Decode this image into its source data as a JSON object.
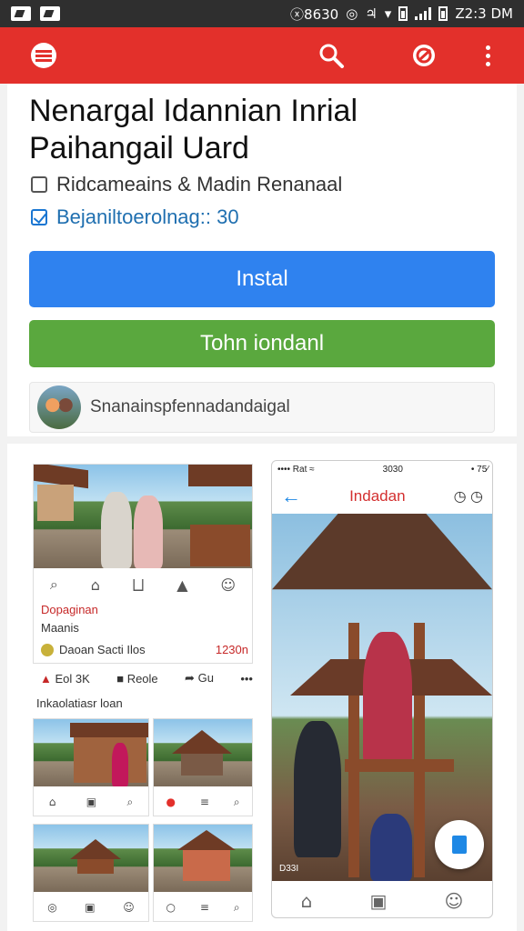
{
  "status_bar": {
    "net": "ⓧ8630",
    "time": "Z2:3 DM"
  },
  "app_bar": {
    "menu_icon": "menu-icon",
    "search_icon": "search-icon",
    "badge_icon": "no-entry-icon",
    "more_icon": "more-vert-icon",
    "accent": "#e3302b"
  },
  "app_info": {
    "title_line1": "Nenargal Idannian Inrial",
    "title_line2": "Paihangail Uard",
    "option1": "Ridcameains & Madin Renanaal",
    "option2": "Bejaniltoerolnag:: 30",
    "install_label": "Instal",
    "secondary_label": "Tohn iondanl",
    "user_text": "Snanainspfennadandaigal"
  },
  "left_preview": {
    "row1": "Dopaginan",
    "row2": "Maanis",
    "row3": "Daoan Sacti Ilos",
    "row3_num": "1230n",
    "like_label": "Eol 3K",
    "reply_label": "Reole",
    "share_label": "Gu",
    "section": "Inkaolatiasr loan"
  },
  "right_preview": {
    "status_left": "•••• Rat ≈",
    "status_mid": "3030",
    "status_right": "• 75∕",
    "title": "Indadan",
    "photo_caption": "D33I"
  }
}
